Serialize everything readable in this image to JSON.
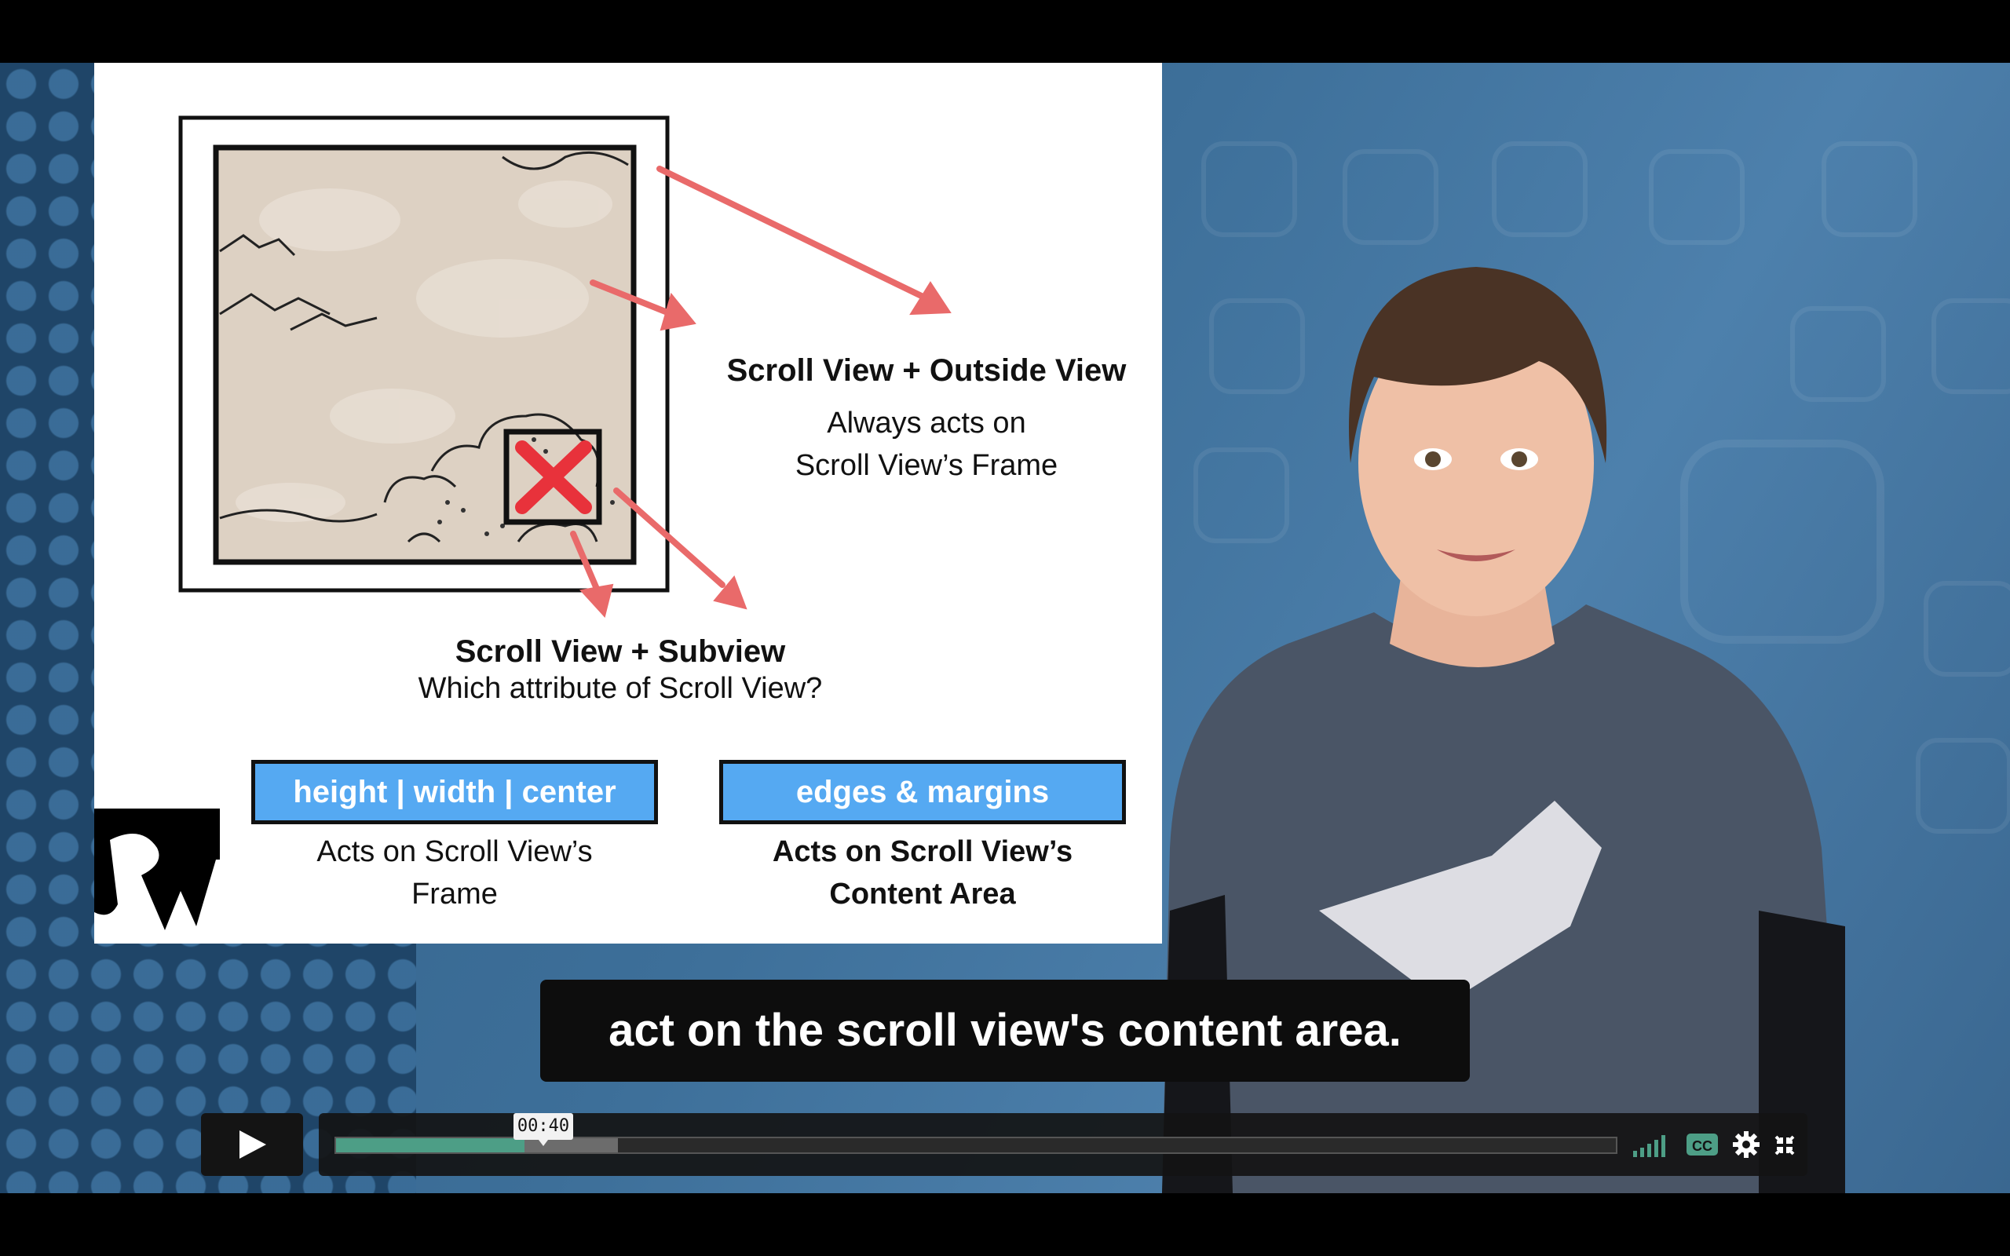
{
  "slide": {
    "outside_title": "Scroll View + Outside View",
    "outside_line1": "Always acts on",
    "outside_line2": "Scroll View’s Frame",
    "subview_title": "Scroll View + Subview",
    "subview_question": "Which attribute of Scroll View?",
    "pill_left": "height | width | center",
    "pill_right": "edges & margins",
    "left_note_line1": "Acts on Scroll View’s",
    "left_note_line2": "Frame",
    "right_note_line1": "Acts on Scroll View’s",
    "right_note_line2": "Content Area",
    "accent_color": "#55a9f2",
    "arrow_color": "#e96a6a"
  },
  "caption": {
    "text": "act on the scroll view's content area."
  },
  "player": {
    "current_time": "00:40",
    "played_fraction": 0.147,
    "buffered_fraction": 0.22,
    "icons": [
      "play-icon",
      "volume-icon",
      "cc-icon",
      "settings-icon",
      "fullscreen-exit-icon"
    ]
  }
}
